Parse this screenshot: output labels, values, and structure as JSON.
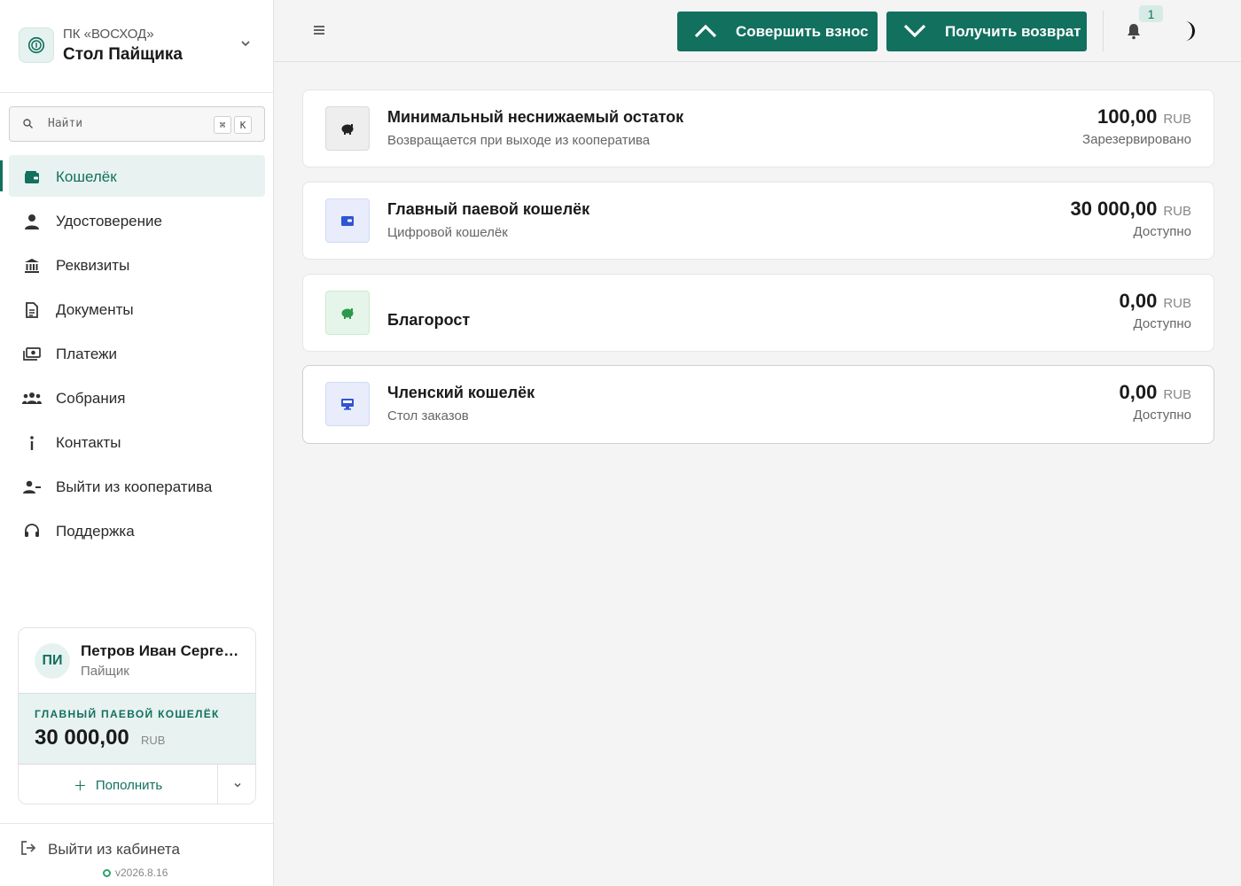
{
  "org": {
    "name": "ПК «ВОСХОД»",
    "title": "Стол Пайщика"
  },
  "search": {
    "placeholder": "Найти",
    "kbd_mod": "⌘",
    "kbd_key": "K"
  },
  "nav": {
    "items": [
      {
        "label": "Кошелёк",
        "icon": "wallet-icon",
        "active": true
      },
      {
        "label": "Удостоверение",
        "icon": "person-icon"
      },
      {
        "label": "Реквизиты",
        "icon": "bank-icon"
      },
      {
        "label": "Документы",
        "icon": "document-icon"
      },
      {
        "label": "Платежи",
        "icon": "payments-icon"
      },
      {
        "label": "Собрания",
        "icon": "groups-icon"
      },
      {
        "label": "Контакты",
        "icon": "info-icon"
      },
      {
        "label": "Выйти из кооператива",
        "icon": "person-remove-icon"
      },
      {
        "label": "Поддержка",
        "icon": "headset-icon"
      }
    ]
  },
  "user": {
    "initials": "ПИ",
    "name": "Петров Иван Сергеевич",
    "role": "Пайщик",
    "wallet_label": "ГЛАВНЫЙ ПАЕВОЙ КОШЕЛЁК",
    "wallet_amount": "30 000,00",
    "wallet_currency": "RUB",
    "topup_label": "Пополнить"
  },
  "footer": {
    "logout_label": "Выйти из кабинета",
    "version": "v2026.8.16"
  },
  "header": {
    "contribute_label": "Совершить взнос",
    "return_label": "Получить возврат",
    "notifications_count": "1"
  },
  "wallets": [
    {
      "title": "Минимальный неснижаемый остаток",
      "subtitle": "Возвращается при выходе из кооператива",
      "amount": "100,00",
      "currency": "RUB",
      "status": "Зарезервировано",
      "icon": "piggy-bank-icon",
      "icon_bg": "#eeeeee"
    },
    {
      "title": "Главный паевой кошелёк",
      "subtitle": "Цифровой кошелёк",
      "amount": "30 000,00",
      "currency": "RUB",
      "status": "Доступно",
      "icon": "wallet-icon",
      "icon_bg": "#e8ecfb"
    },
    {
      "title": "Благорост",
      "subtitle": "",
      "amount": "0,00",
      "currency": "RUB",
      "status": "Доступно",
      "icon": "savings-icon",
      "icon_bg": "#e6f5ea"
    },
    {
      "title": "Членский кошелёк",
      "subtitle": "Стол заказов",
      "amount": "0,00",
      "currency": "RUB",
      "status": "Доступно",
      "icon": "desktop-icon",
      "icon_bg": "#e8ecfb"
    }
  ],
  "colors": {
    "accent": "#12705f",
    "accent_light": "#e8f2f0",
    "blue_icon": "#2f55d4",
    "green_icon": "#2c9a4a"
  }
}
